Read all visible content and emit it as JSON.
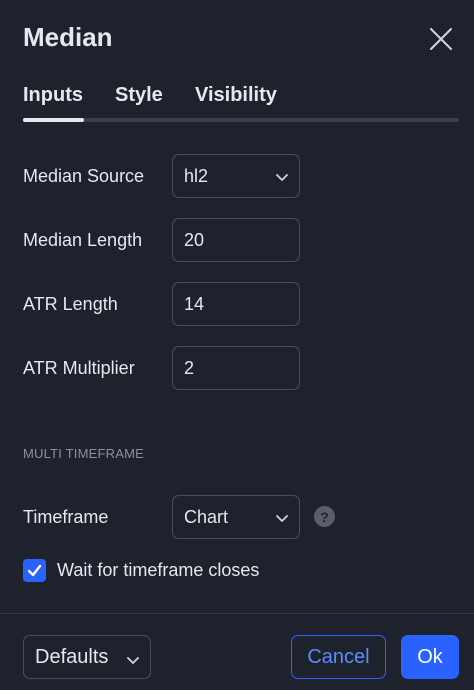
{
  "dialog": {
    "title": "Median",
    "close_icon": "close-icon"
  },
  "tabs": [
    {
      "label": "Inputs",
      "active": true
    },
    {
      "label": "Style",
      "active": false
    },
    {
      "label": "Visibility",
      "active": false
    }
  ],
  "inputs": {
    "median_source": {
      "label": "Median Source",
      "value": "hl2"
    },
    "median_length": {
      "label": "Median Length",
      "value": "20"
    },
    "atr_length": {
      "label": "ATR Length",
      "value": "14"
    },
    "atr_multiplier": {
      "label": "ATR Multiplier",
      "value": "2"
    }
  },
  "multi_timeframe": {
    "section_title": "MULTI TIMEFRAME",
    "timeframe": {
      "label": "Timeframe",
      "value": "Chart"
    },
    "help_icon": "question-icon",
    "help_glyph": "?",
    "wait_closes": {
      "label": "Wait for timeframe closes",
      "checked": true
    }
  },
  "footer": {
    "defaults_label": "Defaults",
    "cancel_label": "Cancel",
    "ok_label": "Ok"
  },
  "colors": {
    "background": "#1e222d",
    "accent": "#2962ff",
    "text": "#e6e8ee",
    "muted": "#8c909b",
    "border": "#4a4f5c"
  }
}
